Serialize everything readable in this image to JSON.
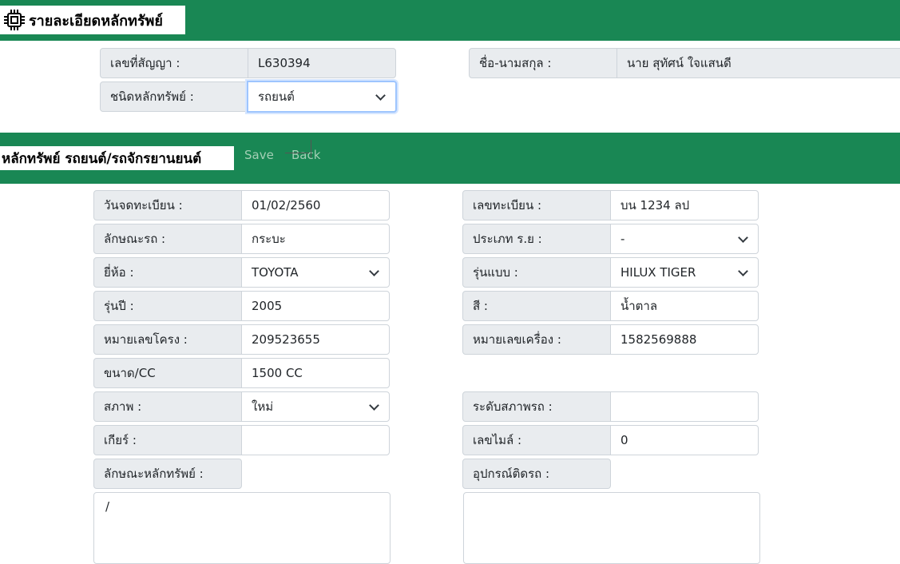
{
  "header": {
    "title": "รายละเอียดหลักทรัพย์",
    "icon": "cpu-chip-icon",
    "accent_color": "#198754"
  },
  "contract": {
    "contract_no_label": "เลขที่สัญญา :",
    "contract_no_value": "L630394",
    "name_label": "ชื่อ-นามสกุล :",
    "name_value": "นาย สุทัศน์ ใจแสนดี",
    "asset_type_label": "ชนิดหลักทรัพย์ :",
    "asset_type_value": "รถยนต์"
  },
  "section": {
    "title": "หลักทรัพย์ รถยนต์/รถจักรยานยนต์",
    "save_label": "Save",
    "back_label": "Back"
  },
  "vehicle": {
    "reg_date_label": "วันจดทะเบียน :",
    "reg_date_value": "01/02/2560",
    "plate_label": "เลขทะเบียน :",
    "plate_value": "บน 1234 ลป",
    "body_label": "ลักษณะรถ :",
    "body_value": "กระบะ",
    "type_label": "ประเภท ร.ย :",
    "type_value": "-",
    "brand_label": "ยี่ห้อ :",
    "brand_value": "TOYOTA",
    "model_label": "รุ่นแบบ :",
    "model_value": "HILUX TIGER",
    "year_label": "รุ่นปี :",
    "year_value": "2005",
    "color_label": "สี :",
    "color_value": "น้ำตาล",
    "chassis_label": "หมายเลขโครง :",
    "chassis_value": "209523655",
    "engine_label": "หมายเลขเครื่อง :",
    "engine_value": "1582569888",
    "cc_label": "ขนาด/CC",
    "cc_value": "1500 CC",
    "condition_label": "สภาพ :",
    "condition_value": "ใหม่",
    "condition_level_label": "ระดับสภาพรถ :",
    "condition_level_value": "",
    "gear_label": "เกียร์ :",
    "gear_value": "",
    "mileage_label": "เลขไมล์ :",
    "mileage_value": "0",
    "asset_desc_label": "ลักษณะหลักทรัพย์ :",
    "asset_desc_value": "/",
    "accessories_label": "อุปกรณ์ติดรถ :",
    "accessories_value": ""
  }
}
